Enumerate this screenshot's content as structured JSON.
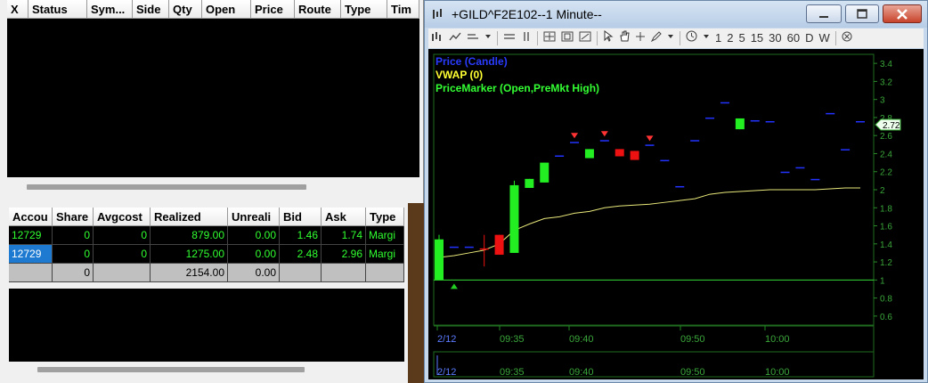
{
  "orders": {
    "columns": [
      "X",
      "Status",
      "Sym...",
      "Side",
      "Qty",
      "Open",
      "Price",
      "Route",
      "Type",
      "Tim"
    ]
  },
  "positions": {
    "columns": [
      "Accou",
      "Share",
      "Avgcost",
      "Realized",
      "Unreali",
      "Bid",
      "Ask",
      "Type"
    ],
    "rows": [
      [
        "12729",
        "0",
        "0",
        "879.00",
        "0.00",
        "1.46",
        "1.74",
        "Margi"
      ],
      [
        "12729",
        "0",
        "0",
        "1275.00",
        "0.00",
        "2.48",
        "2.96",
        "Margi"
      ]
    ],
    "total": [
      "",
      "0",
      "",
      "2154.00",
      "0.00",
      "",
      "",
      ""
    ]
  },
  "chart_window": {
    "title": "+GILD^F2E102--1 Minute--",
    "toolbar": {
      "periods": [
        "1",
        "2",
        "5",
        "15",
        "30",
        "60",
        "D",
        "W"
      ]
    }
  },
  "chart_data": {
    "type": "candlestick",
    "legend": [
      {
        "text": "Price (Candle)",
        "color": "#2a3cff"
      },
      {
        "text": "VWAP (0)",
        "color": "#ffff33"
      },
      {
        "text": "PriceMarker (Open,PreMkt High)",
        "color": "#33ff33"
      }
    ],
    "ylim": [
      0.5,
      3.5
    ],
    "y_ticks": [
      "3.4",
      "3.2",
      "3",
      "2.8",
      "2.6",
      "2.4",
      "2.2",
      "2",
      "1.8",
      "1.6",
      "1.4",
      "1.2",
      "1",
      "0.8",
      "0.6"
    ],
    "last_price_label": "2.72",
    "x_ticks": [
      "2/12",
      "09:35",
      "09:40",
      "09:50",
      "10:00"
    ],
    "candles": [
      {
        "o": 1.0,
        "c": 1.45,
        "h": 1.5,
        "l": 1.0,
        "color": "green"
      },
      {
        "o": 1.37,
        "c": 1.37,
        "h": 1.37,
        "l": 1.37,
        "color": "blue"
      },
      {
        "o": 1.37,
        "c": 1.37,
        "h": 1.37,
        "l": 1.37,
        "color": "blue"
      },
      {
        "o": 1.35,
        "c": 1.35,
        "h": 1.5,
        "l": 1.15,
        "color": "red"
      },
      {
        "o": 1.5,
        "c": 1.28,
        "h": 1.5,
        "l": 1.28,
        "color": "red"
      },
      {
        "o": 1.3,
        "c": 2.05,
        "h": 2.1,
        "l": 1.3,
        "color": "green"
      },
      {
        "o": 2.02,
        "c": 2.12,
        "h": 2.12,
        "l": 2.02,
        "color": "green"
      },
      {
        "o": 2.08,
        "c": 2.3,
        "h": 2.3,
        "l": 2.08,
        "color": "green"
      },
      {
        "o": 2.38,
        "c": 2.38,
        "h": 2.38,
        "l": 2.38,
        "color": "blue"
      },
      {
        "o": 2.53,
        "c": 2.53,
        "h": 2.53,
        "l": 2.53,
        "color": "blue"
      },
      {
        "o": 2.35,
        "c": 2.45,
        "h": 2.45,
        "l": 2.35,
        "color": "green"
      },
      {
        "o": 2.55,
        "c": 2.55,
        "h": 2.55,
        "l": 2.55,
        "color": "blue"
      },
      {
        "o": 2.45,
        "c": 2.37,
        "h": 2.45,
        "l": 2.37,
        "color": "red"
      },
      {
        "o": 2.43,
        "c": 2.33,
        "h": 2.43,
        "l": 2.33,
        "color": "red"
      },
      {
        "o": 2.5,
        "c": 2.5,
        "h": 2.5,
        "l": 2.5,
        "color": "blue"
      },
      {
        "o": 2.33,
        "c": 2.33,
        "h": 2.33,
        "l": 2.33,
        "color": "blue"
      },
      {
        "o": 2.04,
        "c": 2.04,
        "h": 2.04,
        "l": 2.04,
        "color": "blue"
      },
      {
        "o": 2.55,
        "c": 2.55,
        "h": 2.55,
        "l": 2.55,
        "color": "blue"
      },
      {
        "o": 2.8,
        "c": 2.8,
        "h": 2.8,
        "l": 2.8,
        "color": "blue"
      },
      {
        "o": 2.97,
        "c": 2.97,
        "h": 2.97,
        "l": 2.97,
        "color": "blue"
      },
      {
        "o": 2.67,
        "c": 2.79,
        "h": 2.79,
        "l": 2.67,
        "color": "green"
      },
      {
        "o": 2.77,
        "c": 2.77,
        "h": 2.77,
        "l": 2.77,
        "color": "blue"
      },
      {
        "o": 2.76,
        "c": 2.76,
        "h": 2.76,
        "l": 2.76,
        "color": "blue"
      },
      {
        "o": 2.2,
        "c": 2.2,
        "h": 2.2,
        "l": 2.2,
        "color": "blue"
      },
      {
        "o": 2.25,
        "c": 2.25,
        "h": 2.25,
        "l": 2.25,
        "color": "blue"
      },
      {
        "o": 2.12,
        "c": 2.12,
        "h": 2.12,
        "l": 2.12,
        "color": "blue"
      },
      {
        "o": 2.85,
        "c": 2.85,
        "h": 2.85,
        "l": 2.85,
        "color": "blue"
      },
      {
        "o": 2.45,
        "c": 2.45,
        "h": 2.45,
        "l": 2.45,
        "color": "blue"
      },
      {
        "o": 2.76,
        "c": 2.76,
        "h": 2.76,
        "l": 2.76,
        "color": "blue"
      }
    ],
    "vwap": [
      1.25,
      1.27,
      1.3,
      1.33,
      1.4,
      1.55,
      1.62,
      1.68,
      1.7,
      1.74,
      1.76,
      1.8,
      1.82,
      1.83,
      1.84,
      1.86,
      1.88,
      1.9,
      1.95,
      1.97,
      1.98,
      1.99,
      2.0,
      2.0,
      2.0,
      2.0,
      2.01,
      2.02,
      2.02
    ],
    "premarket_high_line": 1.0,
    "markers": {
      "sell": [
        9,
        11,
        14
      ],
      "buy_below": [
        1
      ]
    }
  }
}
